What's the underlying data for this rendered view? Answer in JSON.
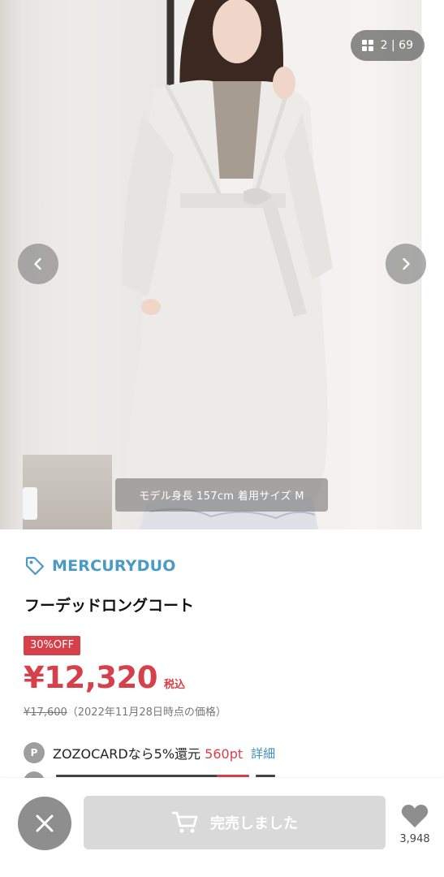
{
  "gallery": {
    "counter_text": "2 | 69",
    "caption": "モデル身長 157cm 着用サイズ M",
    "prev_icon": "chevron-left-icon",
    "next_icon": "chevron-right-icon"
  },
  "product": {
    "brand": "MERCURYDUO",
    "title": "フーデッドロングコート",
    "discount_badge": "30%OFF",
    "price": "¥12,320",
    "tax_label": "税込",
    "original_price": "¥17,600",
    "original_price_note": "（2022年11月28日時点の価格）"
  },
  "points": {
    "icon_label": "P",
    "text": "ZOZOCARDなら5%還元",
    "value": "560pt",
    "detail_link": "詳細"
  },
  "bottom_bar": {
    "cart_label": "完売しました",
    "favorite_count": "3,948"
  },
  "colors": {
    "accent_red": "#d6404a",
    "brand_blue": "#4a9bc4",
    "link_blue": "#3f8fc4",
    "disabled_gray": "#d9d9d9"
  }
}
